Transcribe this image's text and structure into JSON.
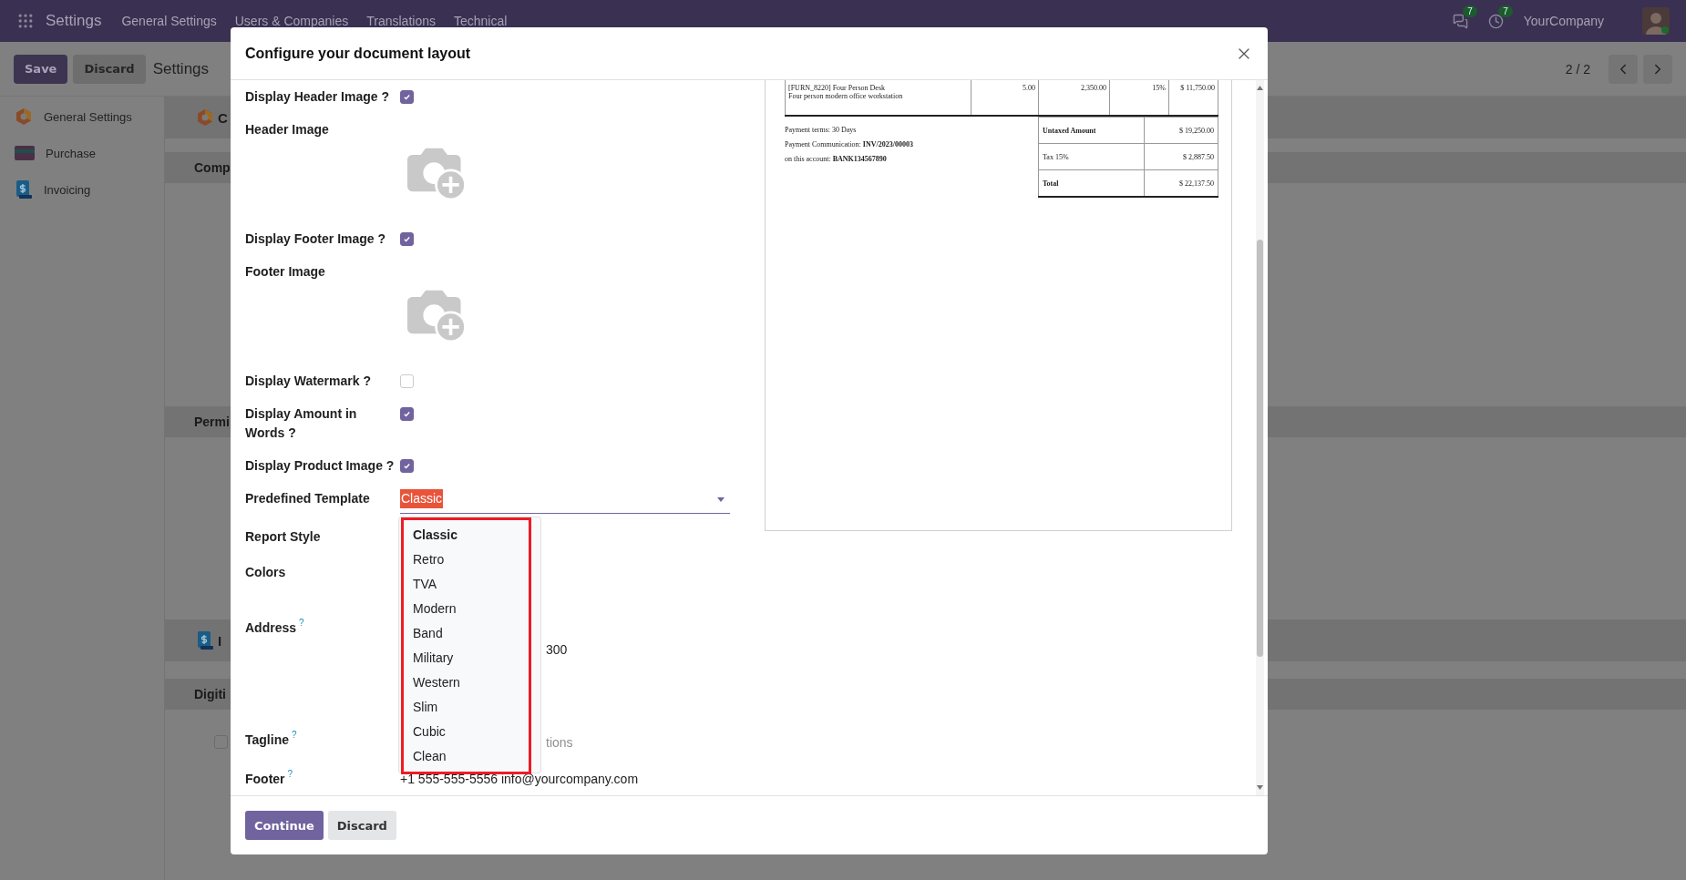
{
  "navbar": {
    "app": "Settings",
    "menu": [
      "General Settings",
      "Users & Companies",
      "Translations",
      "Technical"
    ],
    "chat_count": "7",
    "activity_count": "7",
    "company": "YourCompany"
  },
  "control_panel": {
    "buttons": [
      "Save",
      "Discard"
    ],
    "title": "Settings",
    "pager": "2 / 2"
  },
  "sidebar": {
    "items": [
      {
        "label": "General Settings",
        "kind": "general"
      },
      {
        "label": "Purchase",
        "kind": "purchase"
      },
      {
        "label": "Invoicing",
        "kind": "invoicing"
      }
    ]
  },
  "background_sections": [
    {
      "title": "C",
      "kind": "app"
    },
    {
      "title": "Comp",
      "kind": "group"
    },
    {
      "title": "Permi",
      "kind": "group"
    },
    {
      "title": "I",
      "kind": "app"
    },
    {
      "title": "Digiti",
      "kind": "group"
    }
  ],
  "background_checkbox": {
    "checked": false
  },
  "dialog": {
    "title": "Configure your document layout",
    "fields": [
      {
        "kind": "checkbox",
        "label": "Display Header Image ?",
        "checked": true
      },
      {
        "kind": "image",
        "label": "Header Image"
      },
      {
        "kind": "checkbox",
        "label": "Display Footer Image ?",
        "checked": true
      },
      {
        "kind": "image",
        "label": "Footer Image"
      },
      {
        "kind": "checkbox",
        "label": "Display Watermark ?",
        "checked": false
      },
      {
        "kind": "checkbox",
        "label": "Display Amount in Words ?",
        "checked": true
      },
      {
        "kind": "checkbox",
        "label": "Display Product Image ?",
        "checked": true
      },
      {
        "kind": "select",
        "label": "Predefined Template",
        "value": "Classic",
        "options": [
          {
            "label": "Classic",
            "selected": true
          },
          {
            "label": "Retro",
            "selected": false
          },
          {
            "label": "TVA",
            "selected": false
          },
          {
            "label": "Modern",
            "selected": false
          },
          {
            "label": "Band",
            "selected": false
          },
          {
            "label": "Military",
            "selected": false
          },
          {
            "label": "Western",
            "selected": false
          },
          {
            "label": "Slim",
            "selected": false
          },
          {
            "label": "Cubic",
            "selected": false
          },
          {
            "label": "Clean",
            "selected": false
          }
        ]
      },
      {
        "kind": "empty",
        "label": "Report Style"
      },
      {
        "kind": "colors",
        "label": "Colors"
      },
      {
        "kind": "address",
        "label": "Address",
        "help": "?",
        "value": "300"
      },
      {
        "kind": "tagline",
        "label": "Tagline",
        "help": "?",
        "placeholder": "tions"
      },
      {
        "kind": "text",
        "label": "Footer",
        "help": "?",
        "value": "+1 555-555-5556 info@yourcompany.com"
      }
    ],
    "preview": {
      "line": {
        "title": "[FURN_8220] Four Person Desk",
        "description": "Four person modern office workstation",
        "cells": [
          "5.00",
          "2,350.00",
          "15%",
          "$ 11,750.00"
        ]
      },
      "notes": [
        "Payment terms: 30 Days",
        "Payment Communication: **INV/2023/00003**",
        "on this account: **BANK134567890**"
      ],
      "totals": [
        {
          "label": "Untaxed Amount",
          "value": "$ 19,250.00",
          "bold": true
        },
        {
          "label": "Tax 15%",
          "value": "$ 2,887.50",
          "bold": false
        },
        {
          "label": "Total",
          "value": "$ 22,137.50",
          "bold": true
        }
      ]
    },
    "buttons": [
      "Continue",
      "Discard"
    ]
  }
}
